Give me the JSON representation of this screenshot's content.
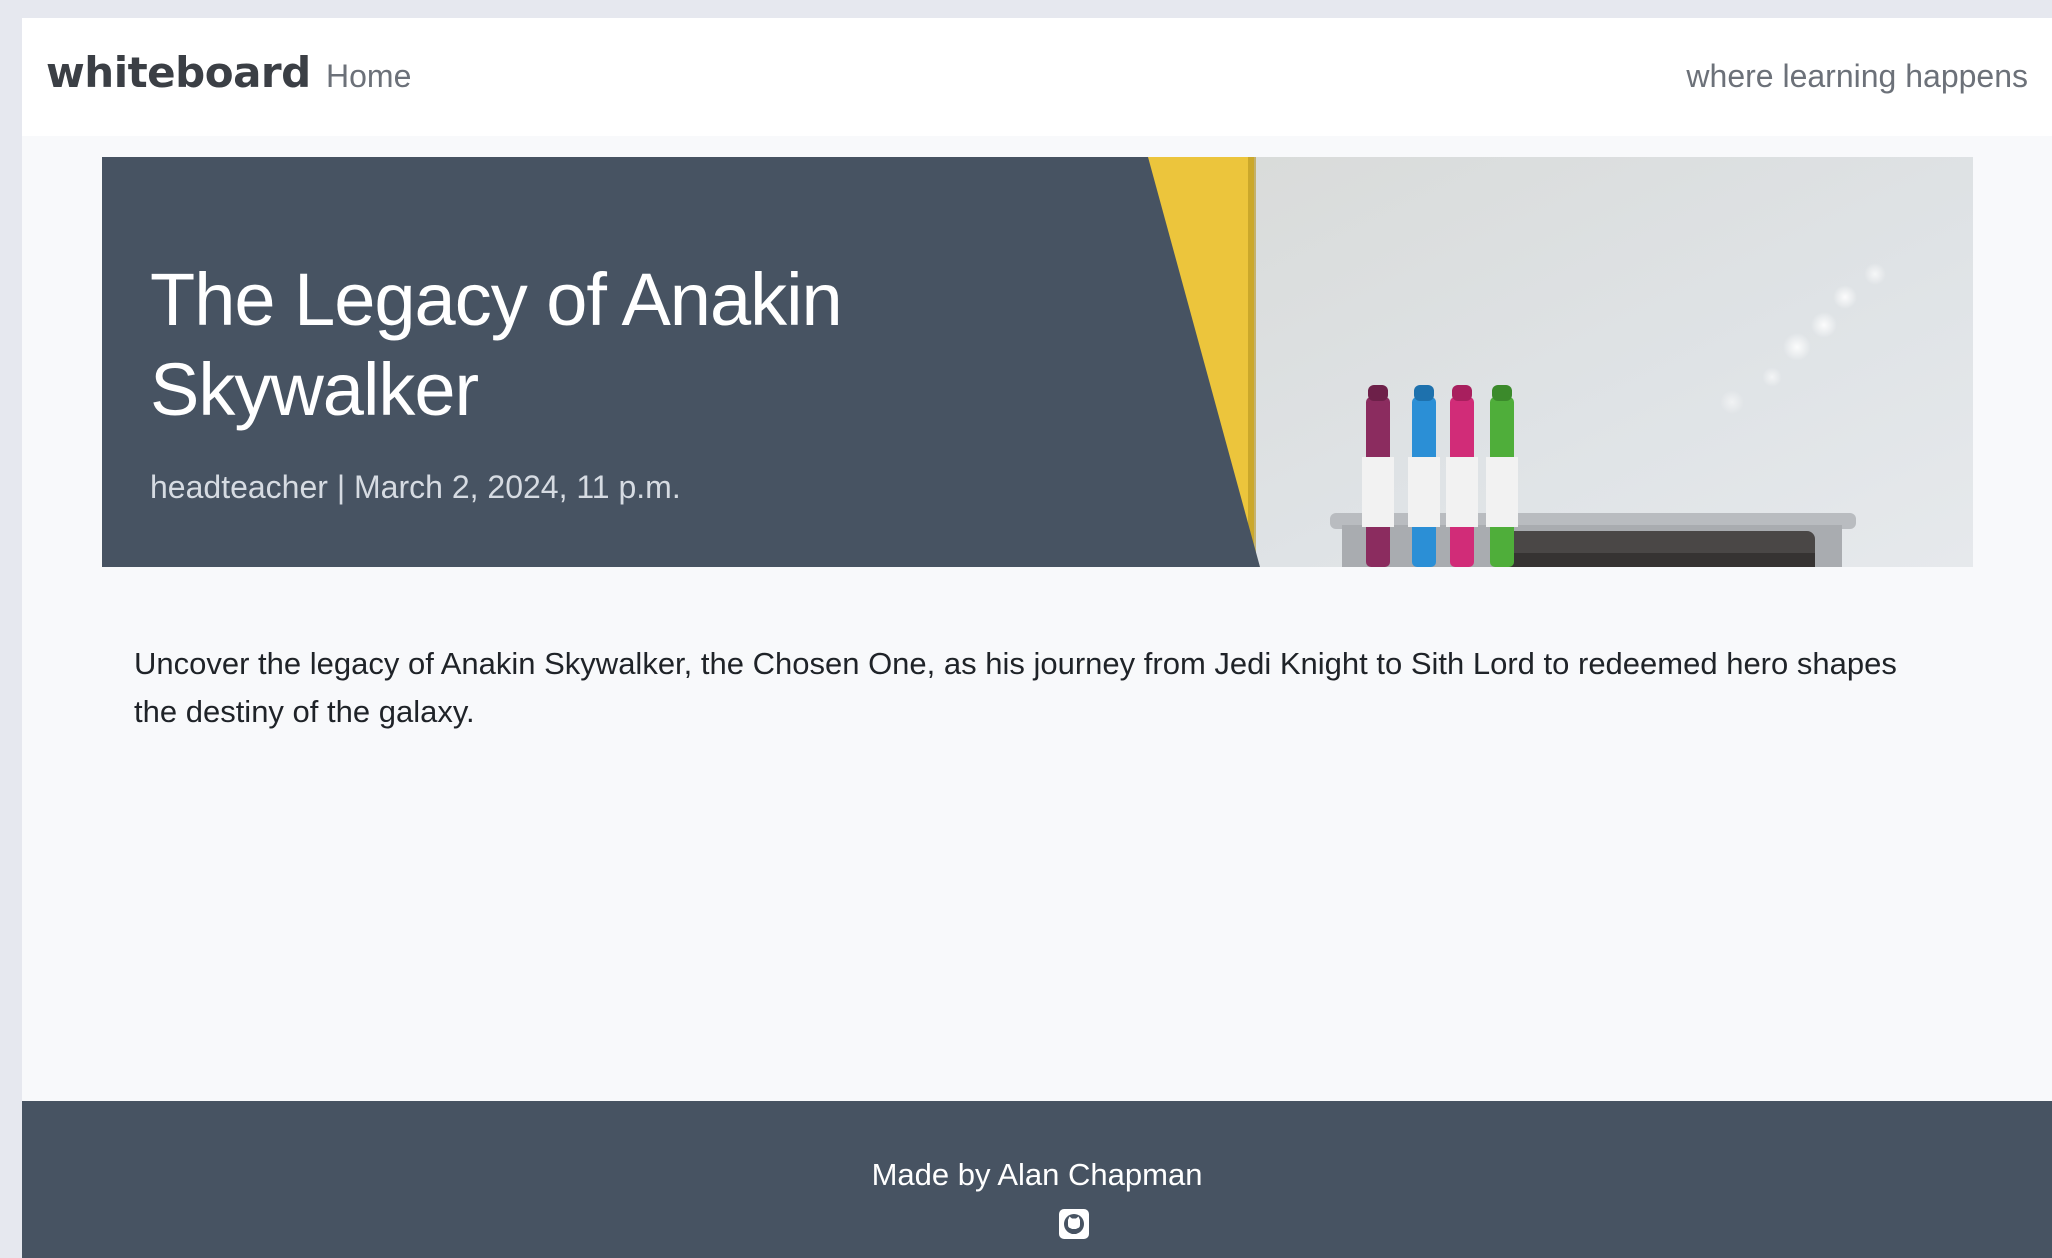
{
  "navbar": {
    "brand": "whiteboard",
    "home_label": "Home",
    "tagline": "where learning happens"
  },
  "hero": {
    "title": "The Legacy of Anakin Skywalker",
    "meta": "headteacher | March 2, 2024, 11 p.m.",
    "image_description_icon": "whiteboard-markers-image"
  },
  "article": {
    "summary": "Uncover the legacy of Anakin Skywalker, the Chosen One, as his journey from Jedi Knight to Sith Lord to redeemed hero shapes the destiny of the galaxy."
  },
  "footer": {
    "credit": "Made by Alan Chapman",
    "icon": "github-icon"
  },
  "colors": {
    "dark_slate": "#475362",
    "accent_yellow": "#ecc53c",
    "page_bg": "#f8f9fb",
    "marker_purple": "#8b2c5f",
    "marker_blue": "#2b8fd6",
    "marker_pink": "#d12c78",
    "marker_green": "#4fae3a"
  }
}
